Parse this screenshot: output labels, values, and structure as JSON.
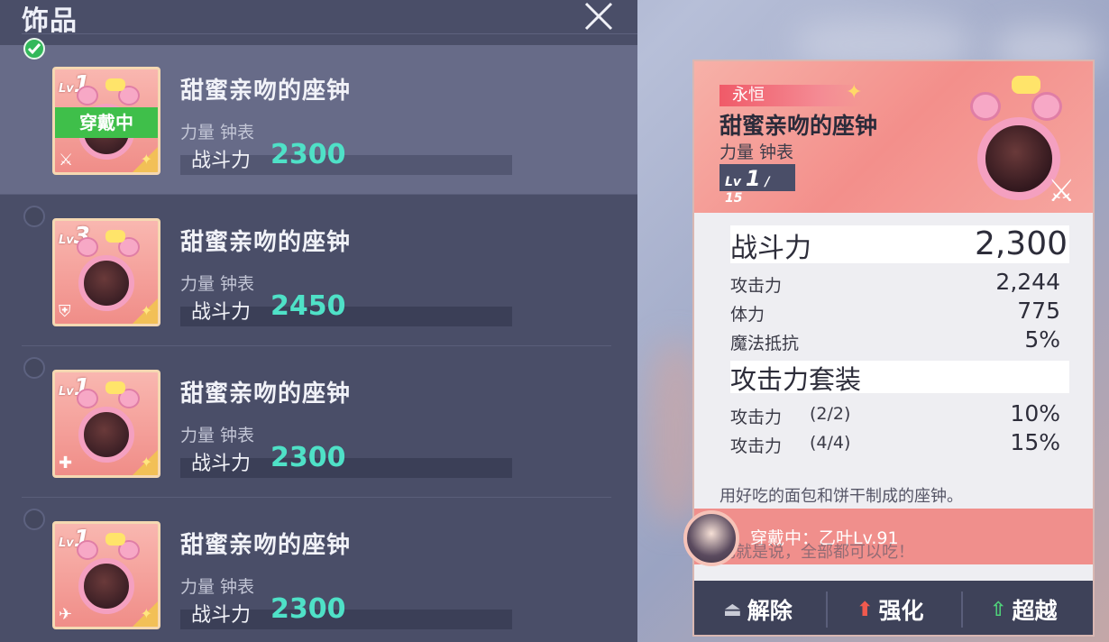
{
  "panel": {
    "title": "饰品",
    "close_icon": "close-icon"
  },
  "items": [
    {
      "level_prefix": "Lv",
      "level": "1",
      "name": "甜蜜亲吻的座钟",
      "type": "力量 钟表",
      "power_label": "战斗力",
      "power": "2300",
      "equipped_label": "穿戴中",
      "type_icon": "sword-icon",
      "selected": true
    },
    {
      "level_prefix": "Lv",
      "level": "3",
      "name": "甜蜜亲吻的座钟",
      "type": "力量 钟表",
      "power_label": "战斗力",
      "power": "2450",
      "type_icon": "shield-icon",
      "selected": false
    },
    {
      "level_prefix": "Lv",
      "level": "1",
      "name": "甜蜜亲吻的座钟",
      "type": "力量 钟表",
      "power_label": "战斗力",
      "power": "2300",
      "type_icon": "heal-icon",
      "selected": false
    },
    {
      "level_prefix": "Lv",
      "level": "1",
      "name": "甜蜜亲吻的座钟",
      "type": "力量 钟表",
      "power_label": "战斗力",
      "power": "2300",
      "type_icon": "wing-icon",
      "selected": false
    }
  ],
  "detail": {
    "rarity": "永恒",
    "name": "甜蜜亲吻的座钟",
    "type": "力量 钟表",
    "level_prefix": "Lv",
    "level": "1",
    "level_max": "/ 15",
    "power_label": "战斗力",
    "power": "2,300",
    "stats": [
      {
        "label": "攻击力",
        "value": "2,244"
      },
      {
        "label": "体力",
        "value": "775"
      },
      {
        "label": "魔法抵抗",
        "value": "5%"
      }
    ],
    "set_title": "攻击力套装",
    "set_bonuses": [
      {
        "label": "攻击力",
        "count": "(2/2)",
        "value": "10%"
      },
      {
        "label": "攻击力",
        "count": "(4/4)",
        "value": "15%"
      }
    ],
    "description": "用好吃的面包和饼干制成的座钟。",
    "description_2": "也就是说，全部都可以吃！",
    "wearing": "穿戴中：乙叶Lv.91"
  },
  "actions": {
    "unequip": "解除",
    "enhance": "强化",
    "transcend": "超越"
  },
  "colors": {
    "panel_bg": "#4a4e68",
    "power_value": "#4fe1c7",
    "equipped_green": "#3fbf4a",
    "card_pink": "#f38f8b",
    "action_bar": "#3e4259"
  }
}
